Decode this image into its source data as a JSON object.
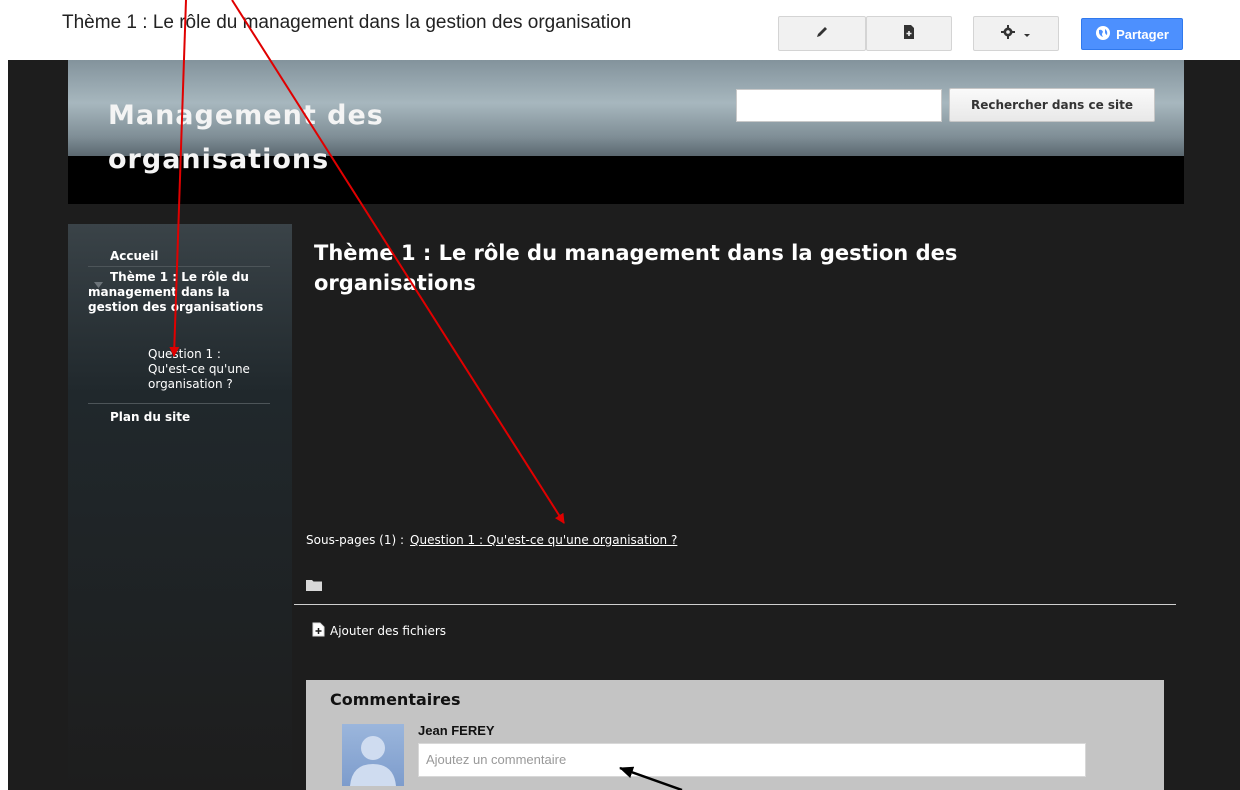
{
  "toolbar": {
    "doc_title": "Thème 1 : Le rôle du management dans la gestion des organisation",
    "edit_icon": "pencil-icon",
    "new_page_icon": "new-page-icon",
    "settings_icon": "gear-icon",
    "share_label": "Partager",
    "share_icon": "globe-icon",
    "share_color": "#4d90fe"
  },
  "header": {
    "site_title": "Management des organisations",
    "search_placeholder": "",
    "search_button": "Rechercher dans ce site"
  },
  "sidebar": {
    "items": [
      {
        "label": "Accueil"
      },
      {
        "label": "Thème 1 : Le rôle du management dans la gestion des organisations",
        "expanded": true
      },
      {
        "label": "Question 1 : Qu'est-ce qu'une organisation ?"
      },
      {
        "label": "Plan du site"
      }
    ]
  },
  "main": {
    "title": "Thème 1 : Le rôle du management dans la gestion des organisations",
    "subpages_label": "Sous-pages (1) :",
    "subpages_link": "Question 1 : Qu'est-ce qu'une organisation ?",
    "add_files": "Ajouter des fichiers"
  },
  "comments": {
    "title": "Commentaires",
    "author": "Jean FEREY",
    "input_placeholder": "Ajoutez un commentaire"
  },
  "annotations": {
    "red_arrow_color": "#e00000",
    "black_arrow_color": "#000000"
  }
}
